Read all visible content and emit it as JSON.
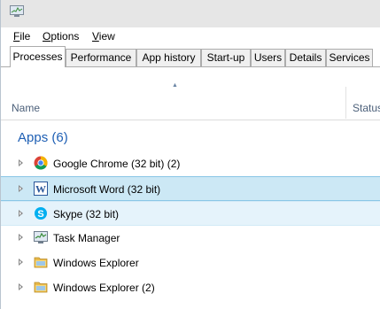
{
  "menu": [
    {
      "underline": "F",
      "rest": "ile"
    },
    {
      "underline": "O",
      "rest": "ptions"
    },
    {
      "underline": "V",
      "rest": "iew"
    }
  ],
  "tabs": [
    "Processes",
    "Performance",
    "App history",
    "Start-up",
    "Users",
    "Details",
    "Services"
  ],
  "active_tab": "Processes",
  "columns": {
    "name": "Name",
    "status": "Status"
  },
  "group": {
    "label": "Apps (6)"
  },
  "rows": [
    {
      "label": "Google Chrome (32 bit) (2)",
      "icon": "chrome-icon",
      "state": "normal"
    },
    {
      "label": "Microsoft Word (32 bit)",
      "icon": "word-icon",
      "state": "selected"
    },
    {
      "label": "Skype (32 bit)",
      "icon": "skype-icon",
      "state": "hover"
    },
    {
      "label": "Task Manager",
      "icon": "task-manager-icon",
      "state": "normal"
    },
    {
      "label": "Windows Explorer",
      "icon": "folder-icon",
      "state": "normal"
    },
    {
      "label": "Windows Explorer (2)",
      "icon": "folder-icon",
      "state": "normal"
    }
  ],
  "colors": {
    "accent": "#1e5fb4",
    "selected": "#cce8f5",
    "hover": "#e5f3fb"
  }
}
